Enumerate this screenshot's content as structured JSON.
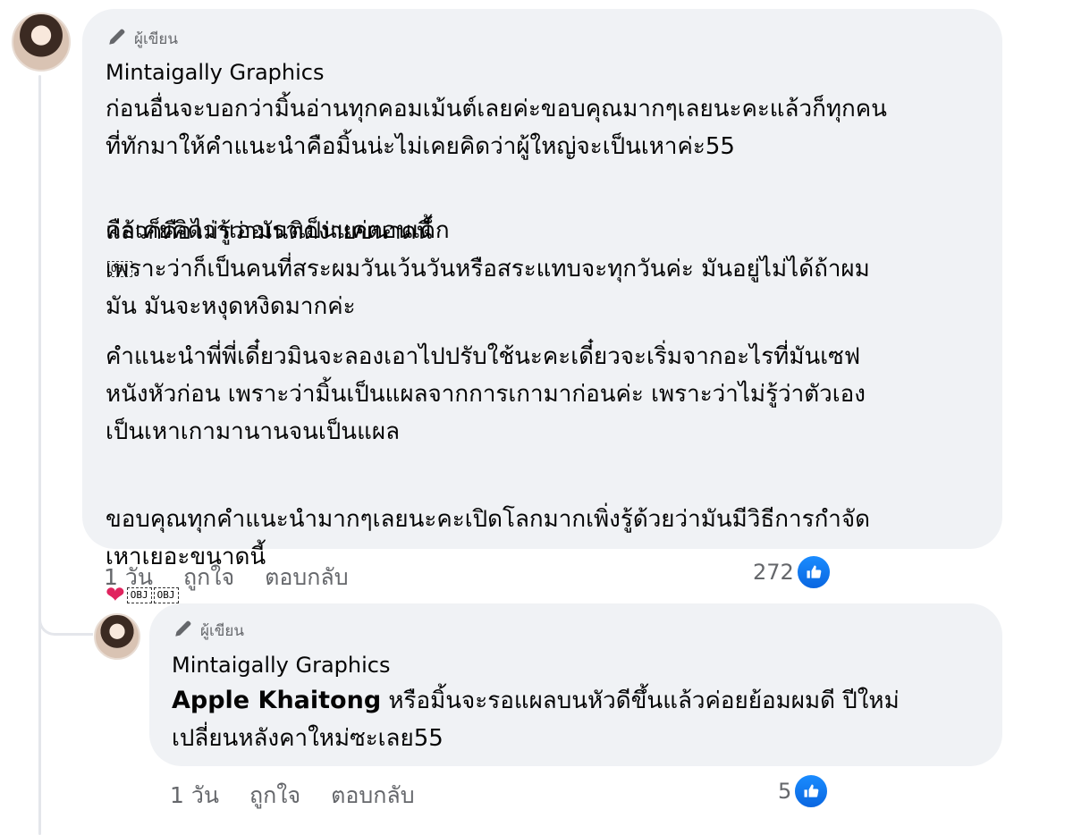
{
  "comment": {
    "author_tag": "ผู้เขียน",
    "author_name": "Mintaigally Graphics",
    "paragraphs": [
      "ก่อนอื่นจะบอกว่ามิ้นอ่านทุกคอมเม้นต์เลยค่ะขอบคุณมากๆเลยนะคะแล้วก็ทุกคน\nที่ทักมาให้คำแนะนำคือมิ้นน่ะไม่เคยคิดว่าผู้ใหญ่จะเป็นเหาค่ะ55",
      "คือเคยคิดว่าเออเราเป็นแค่ตอนเด็ก",
      "แล้วก็คือไม่รู้ว่ามันติดง่ายขนาดนี้\nเพราะว่าก็เป็นคนที่สระผมวันเว้นวันหรือสระแทบจะทุกวันค่ะ มันอยู่ไม่ได้ถ้าผม\nมัน มันจะหงุดหงิดมากค่ะ",
      "คำแนะนำพี่พี่เดี๋ยวมินจะลองเอาไปปรับใช้นะคะเดี๋ยวจะเริ่มจากอะไรที่มันเซฟ\nหนังหัวก่อน เพราะว่ามิ้นเป็นแผลจากการเกามาก่อนค่ะ เพราะว่าไม่รู้ว่าตัวเอง\nเป็นเหาเกามานานจนเป็นแผล",
      "ขอบคุณทุกคำแนะนำมากๆเลยนะคะเปิดโลกมากเพิ่งรู้ด้วยว่ามันมีวิธีการกำจัด\nเหาเยอะขนาดนี้"
    ],
    "obj_glyph": "OBJ",
    "time": "1 วัน",
    "like_label": "ถูกใจ",
    "reply_label": "ตอบกลับ",
    "reaction_count": "272"
  },
  "reply": {
    "author_tag": "ผู้เขียน",
    "author_name": "Mintaigally Graphics",
    "mention": "Apple Khaitong",
    "text_line1": " หรือมิ้นจะรอแผลบนหัวดีขึ้นแล้วค่อยย้อมผมดี ปีใหม่",
    "text_line2": "เปลี่ยนหลังคาใหม่ซะเลย55",
    "time": "1 วัน",
    "like_label": "ถูกใจ",
    "reply_label": "ตอบกลับ",
    "reaction_count": "5"
  },
  "icons": {
    "author_tag_icon": "pencil-icon",
    "reaction_icon": "like-thumb-icon",
    "heart_icon": "heart-emoji-icon",
    "like_color": "#1877f2"
  }
}
